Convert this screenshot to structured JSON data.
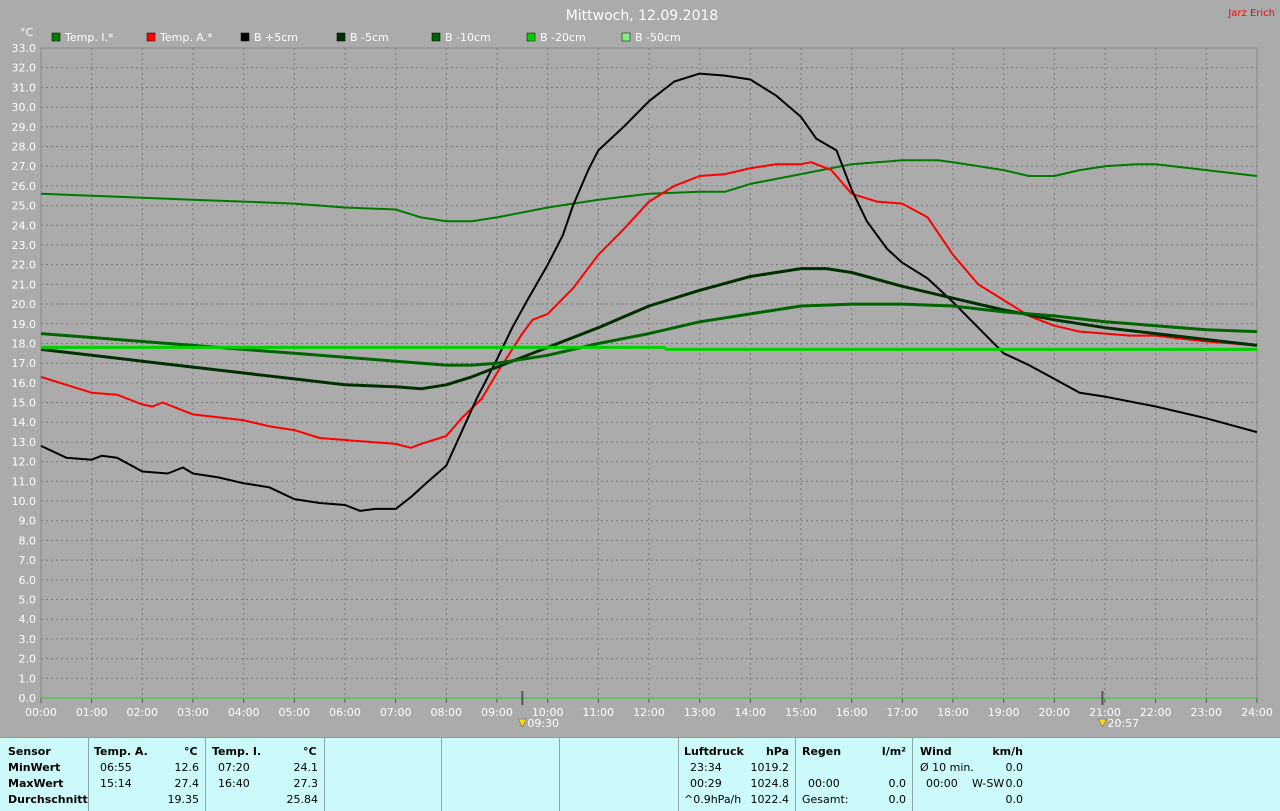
{
  "window": {
    "title": "Mittwoch, 12.09.2018",
    "author": "Jarz Erich"
  },
  "colors": {
    "background": "#ababab",
    "grid": "#7a7a7a",
    "axis_text": "#ffffff",
    "title_text": "#ffffff",
    "author_text": "#ff0000",
    "stats_bg": "#ccfafa"
  },
  "chart_data": {
    "type": "line",
    "ylabel": "°C",
    "ylim": [
      0,
      33
    ],
    "yticks": [
      "0.0",
      "1.0",
      "2.0",
      "3.0",
      "4.0",
      "5.0",
      "6.0",
      "7.0",
      "8.0",
      "9.0",
      "10.0",
      "11.0",
      "12.0",
      "13.0",
      "14.0",
      "15.0",
      "16.0",
      "17.0",
      "18.0",
      "19.0",
      "20.0",
      "21.0",
      "22.0",
      "23.0",
      "24.0",
      "25.0",
      "26.0",
      "27.0",
      "28.0",
      "29.0",
      "30.0",
      "31.0",
      "32.0",
      "33.0"
    ],
    "xlim": [
      0,
      24
    ],
    "xticks": [
      "00:00",
      "01:00",
      "02:00",
      "03:00",
      "04:00",
      "05:00",
      "06:00",
      "07:00",
      "08:00",
      "09:00",
      "10:00",
      "11:00",
      "12:00",
      "13:00",
      "14:00",
      "15:00",
      "16:00",
      "17:00",
      "18:00",
      "19:00",
      "20:00",
      "21:00",
      "22:00",
      "23:00",
      "24:00"
    ],
    "grid": true,
    "legend_position": "top",
    "markers": [
      {
        "x": 9.5,
        "label": "09:30",
        "icon": "sunrise-icon"
      },
      {
        "x": 20.95,
        "label": "20:57",
        "icon": "sunset-icon"
      }
    ],
    "series": [
      {
        "name": "Temp. I.*",
        "color": "#007a00",
        "width": 2,
        "points": [
          [
            0,
            25.6
          ],
          [
            1,
            25.5
          ],
          [
            2,
            25.4
          ],
          [
            3,
            25.3
          ],
          [
            4,
            25.2
          ],
          [
            5,
            25.1
          ],
          [
            6,
            24.9
          ],
          [
            7,
            24.8
          ],
          [
            7.5,
            24.4
          ],
          [
            8,
            24.2
          ],
          [
            8.5,
            24.2
          ],
          [
            9,
            24.4
          ],
          [
            10,
            24.9
          ],
          [
            11,
            25.3
          ],
          [
            12,
            25.6
          ],
          [
            13,
            25.7
          ],
          [
            13.5,
            25.7
          ],
          [
            14,
            26.1
          ],
          [
            15,
            26.6
          ],
          [
            16,
            27.1
          ],
          [
            17,
            27.3
          ],
          [
            17.7,
            27.3
          ],
          [
            18,
            27.2
          ],
          [
            19,
            26.8
          ],
          [
            19.5,
            26.5
          ],
          [
            20,
            26.5
          ],
          [
            20.5,
            26.8
          ],
          [
            21,
            27.0
          ],
          [
            21.6,
            27.1
          ],
          [
            22,
            27.1
          ],
          [
            23,
            26.8
          ],
          [
            24,
            26.5
          ]
        ]
      },
      {
        "name": "Temp. A.*",
        "color": "#ff0000",
        "width": 2,
        "points": [
          [
            0,
            16.3
          ],
          [
            0.5,
            15.9
          ],
          [
            1,
            15.5
          ],
          [
            1.5,
            15.4
          ],
          [
            2,
            14.9
          ],
          [
            2.2,
            14.8
          ],
          [
            2.4,
            15.0
          ],
          [
            3,
            14.4
          ],
          [
            4,
            14.1
          ],
          [
            4.5,
            13.8
          ],
          [
            5,
            13.6
          ],
          [
            5.5,
            13.2
          ],
          [
            6,
            13.1
          ],
          [
            7,
            12.9
          ],
          [
            7.3,
            12.7
          ],
          [
            7.5,
            12.9
          ],
          [
            8,
            13.3
          ],
          [
            8.3,
            14.2
          ],
          [
            8.7,
            15.2
          ],
          [
            9,
            16.5
          ],
          [
            9.5,
            18.5
          ],
          [
            9.7,
            19.2
          ],
          [
            10,
            19.5
          ],
          [
            10.5,
            20.8
          ],
          [
            11,
            22.5
          ],
          [
            11.5,
            23.8
          ],
          [
            12,
            25.2
          ],
          [
            12.5,
            26.0
          ],
          [
            13,
            26.5
          ],
          [
            13.5,
            26.6
          ],
          [
            14,
            26.9
          ],
          [
            14.5,
            27.1
          ],
          [
            15,
            27.1
          ],
          [
            15.2,
            27.2
          ],
          [
            15.6,
            26.8
          ],
          [
            16,
            25.6
          ],
          [
            16.5,
            25.2
          ],
          [
            17,
            25.1
          ],
          [
            17.5,
            24.4
          ],
          [
            18,
            22.5
          ],
          [
            18.5,
            21.0
          ],
          [
            19,
            20.2
          ],
          [
            19.5,
            19.4
          ],
          [
            20,
            18.9
          ],
          [
            20.5,
            18.6
          ],
          [
            21,
            18.5
          ],
          [
            21.5,
            18.4
          ],
          [
            22,
            18.4
          ],
          [
            23,
            18.1
          ],
          [
            24,
            17.9
          ]
        ]
      },
      {
        "name": "B +5cm",
        "color": "#000000",
        "width": 2,
        "points": [
          [
            0,
            12.8
          ],
          [
            0.5,
            12.2
          ],
          [
            1,
            12.1
          ],
          [
            1.2,
            12.3
          ],
          [
            1.5,
            12.2
          ],
          [
            2,
            11.5
          ],
          [
            2.5,
            11.4
          ],
          [
            2.8,
            11.7
          ],
          [
            3,
            11.4
          ],
          [
            3.5,
            11.2
          ],
          [
            4,
            10.9
          ],
          [
            4.5,
            10.7
          ],
          [
            5,
            10.1
          ],
          [
            5.5,
            9.9
          ],
          [
            6,
            9.8
          ],
          [
            6.3,
            9.5
          ],
          [
            6.6,
            9.6
          ],
          [
            7,
            9.6
          ],
          [
            7.3,
            10.2
          ],
          [
            7.6,
            10.9
          ],
          [
            8,
            11.8
          ],
          [
            8.3,
            13.5
          ],
          [
            8.6,
            15.2
          ],
          [
            9,
            17.2
          ],
          [
            9.3,
            18.8
          ],
          [
            9.6,
            20.2
          ],
          [
            10,
            22.0
          ],
          [
            10.3,
            23.5
          ],
          [
            10.5,
            25.0
          ],
          [
            10.8,
            26.8
          ],
          [
            11,
            27.8
          ],
          [
            11.5,
            29.0
          ],
          [
            12,
            30.3
          ],
          [
            12.5,
            31.3
          ],
          [
            13,
            31.7
          ],
          [
            13.5,
            31.6
          ],
          [
            14,
            31.4
          ],
          [
            14.5,
            30.6
          ],
          [
            15,
            29.5
          ],
          [
            15.3,
            28.4
          ],
          [
            15.7,
            27.8
          ],
          [
            16,
            25.8
          ],
          [
            16.3,
            24.2
          ],
          [
            16.7,
            22.8
          ],
          [
            17,
            22.1
          ],
          [
            17.5,
            21.3
          ],
          [
            18,
            20.1
          ],
          [
            18.5,
            18.8
          ],
          [
            19,
            17.5
          ],
          [
            19.5,
            16.9
          ],
          [
            20,
            16.2
          ],
          [
            20.5,
            15.5
          ],
          [
            21,
            15.3
          ],
          [
            22,
            14.8
          ],
          [
            23,
            14.2
          ],
          [
            24,
            13.5
          ]
        ]
      },
      {
        "name": "B -5cm",
        "color": "#003000",
        "width": 3,
        "points": [
          [
            0,
            17.7
          ],
          [
            1,
            17.4
          ],
          [
            2,
            17.1
          ],
          [
            3,
            16.8
          ],
          [
            4,
            16.5
          ],
          [
            5,
            16.2
          ],
          [
            6,
            15.9
          ],
          [
            7,
            15.8
          ],
          [
            7.5,
            15.7
          ],
          [
            8,
            15.9
          ],
          [
            8.5,
            16.3
          ],
          [
            9,
            16.8
          ],
          [
            10,
            17.8
          ],
          [
            11,
            18.8
          ],
          [
            12,
            19.9
          ],
          [
            13,
            20.7
          ],
          [
            14,
            21.4
          ],
          [
            15,
            21.8
          ],
          [
            15.5,
            21.8
          ],
          [
            16,
            21.6
          ],
          [
            17,
            20.9
          ],
          [
            18,
            20.3
          ],
          [
            19,
            19.7
          ],
          [
            20,
            19.2
          ],
          [
            21,
            18.8
          ],
          [
            22,
            18.5
          ],
          [
            23,
            18.2
          ],
          [
            24,
            17.9
          ]
        ]
      },
      {
        "name": "B -10cm",
        "color": "#006400",
        "width": 3,
        "points": [
          [
            0,
            18.5
          ],
          [
            1,
            18.3
          ],
          [
            2,
            18.1
          ],
          [
            3,
            17.9
          ],
          [
            4,
            17.7
          ],
          [
            5,
            17.5
          ],
          [
            6,
            17.3
          ],
          [
            7,
            17.1
          ],
          [
            8,
            16.9
          ],
          [
            8.5,
            16.9
          ],
          [
            9,
            17.0
          ],
          [
            10,
            17.4
          ],
          [
            11,
            18.0
          ],
          [
            12,
            18.5
          ],
          [
            13,
            19.1
          ],
          [
            14,
            19.5
          ],
          [
            15,
            19.9
          ],
          [
            16,
            20.0
          ],
          [
            17,
            20.0
          ],
          [
            18,
            19.9
          ],
          [
            19,
            19.6
          ],
          [
            20,
            19.4
          ],
          [
            21,
            19.1
          ],
          [
            22,
            18.9
          ],
          [
            23,
            18.7
          ],
          [
            24,
            18.6
          ]
        ]
      },
      {
        "name": "B -20cm",
        "color": "#00d000",
        "width": 3,
        "points": [
          [
            0,
            17.8
          ],
          [
            8,
            17.8
          ],
          [
            10,
            17.8
          ],
          [
            12,
            17.8
          ],
          [
            12.3,
            17.8
          ],
          [
            12.35,
            17.7
          ],
          [
            24,
            17.7
          ]
        ]
      },
      {
        "name": "B -50cm",
        "color": "#80f080",
        "width": 1,
        "points": []
      }
    ]
  },
  "stats": {
    "sensor": {
      "label": "Sensor",
      "min": "MinWert",
      "max": "MaxWert",
      "avg": "Durchschnitt"
    },
    "temp_a": {
      "label": "Temp. A.",
      "unit": "°C",
      "min_time": "06:55",
      "min_val": "12.6",
      "max_time": "15:14",
      "max_val": "27.4",
      "avg_val": "19.35"
    },
    "temp_i": {
      "label": "Temp. I.",
      "unit": "°C",
      "min_time": "07:20",
      "min_val": "24.1",
      "max_time": "16:40",
      "max_val": "27.3",
      "avg_val": "25.84"
    },
    "pressure": {
      "label": "Luftdruck",
      "unit": "hPa",
      "min_time": "23:34",
      "min_val": "1019.2",
      "max_time": "00:29",
      "max_val": "1024.8",
      "trend": "^0.9hPa/h",
      "trend_val": "1022.4"
    },
    "rain": {
      "label": "Regen",
      "unit": "l/m²",
      "max_time": "00:00",
      "max_val": "0.0",
      "total_label": "Gesamt:",
      "total_val": "0.0"
    },
    "wind": {
      "label": "Wind",
      "unit": "km/h",
      "avg_label": "Ø 10 min.",
      "avg_val": "0.0",
      "max_time": "00:00",
      "max_dir": "W-SW",
      "max_val": "0.0",
      "last_val": "0.0"
    }
  }
}
